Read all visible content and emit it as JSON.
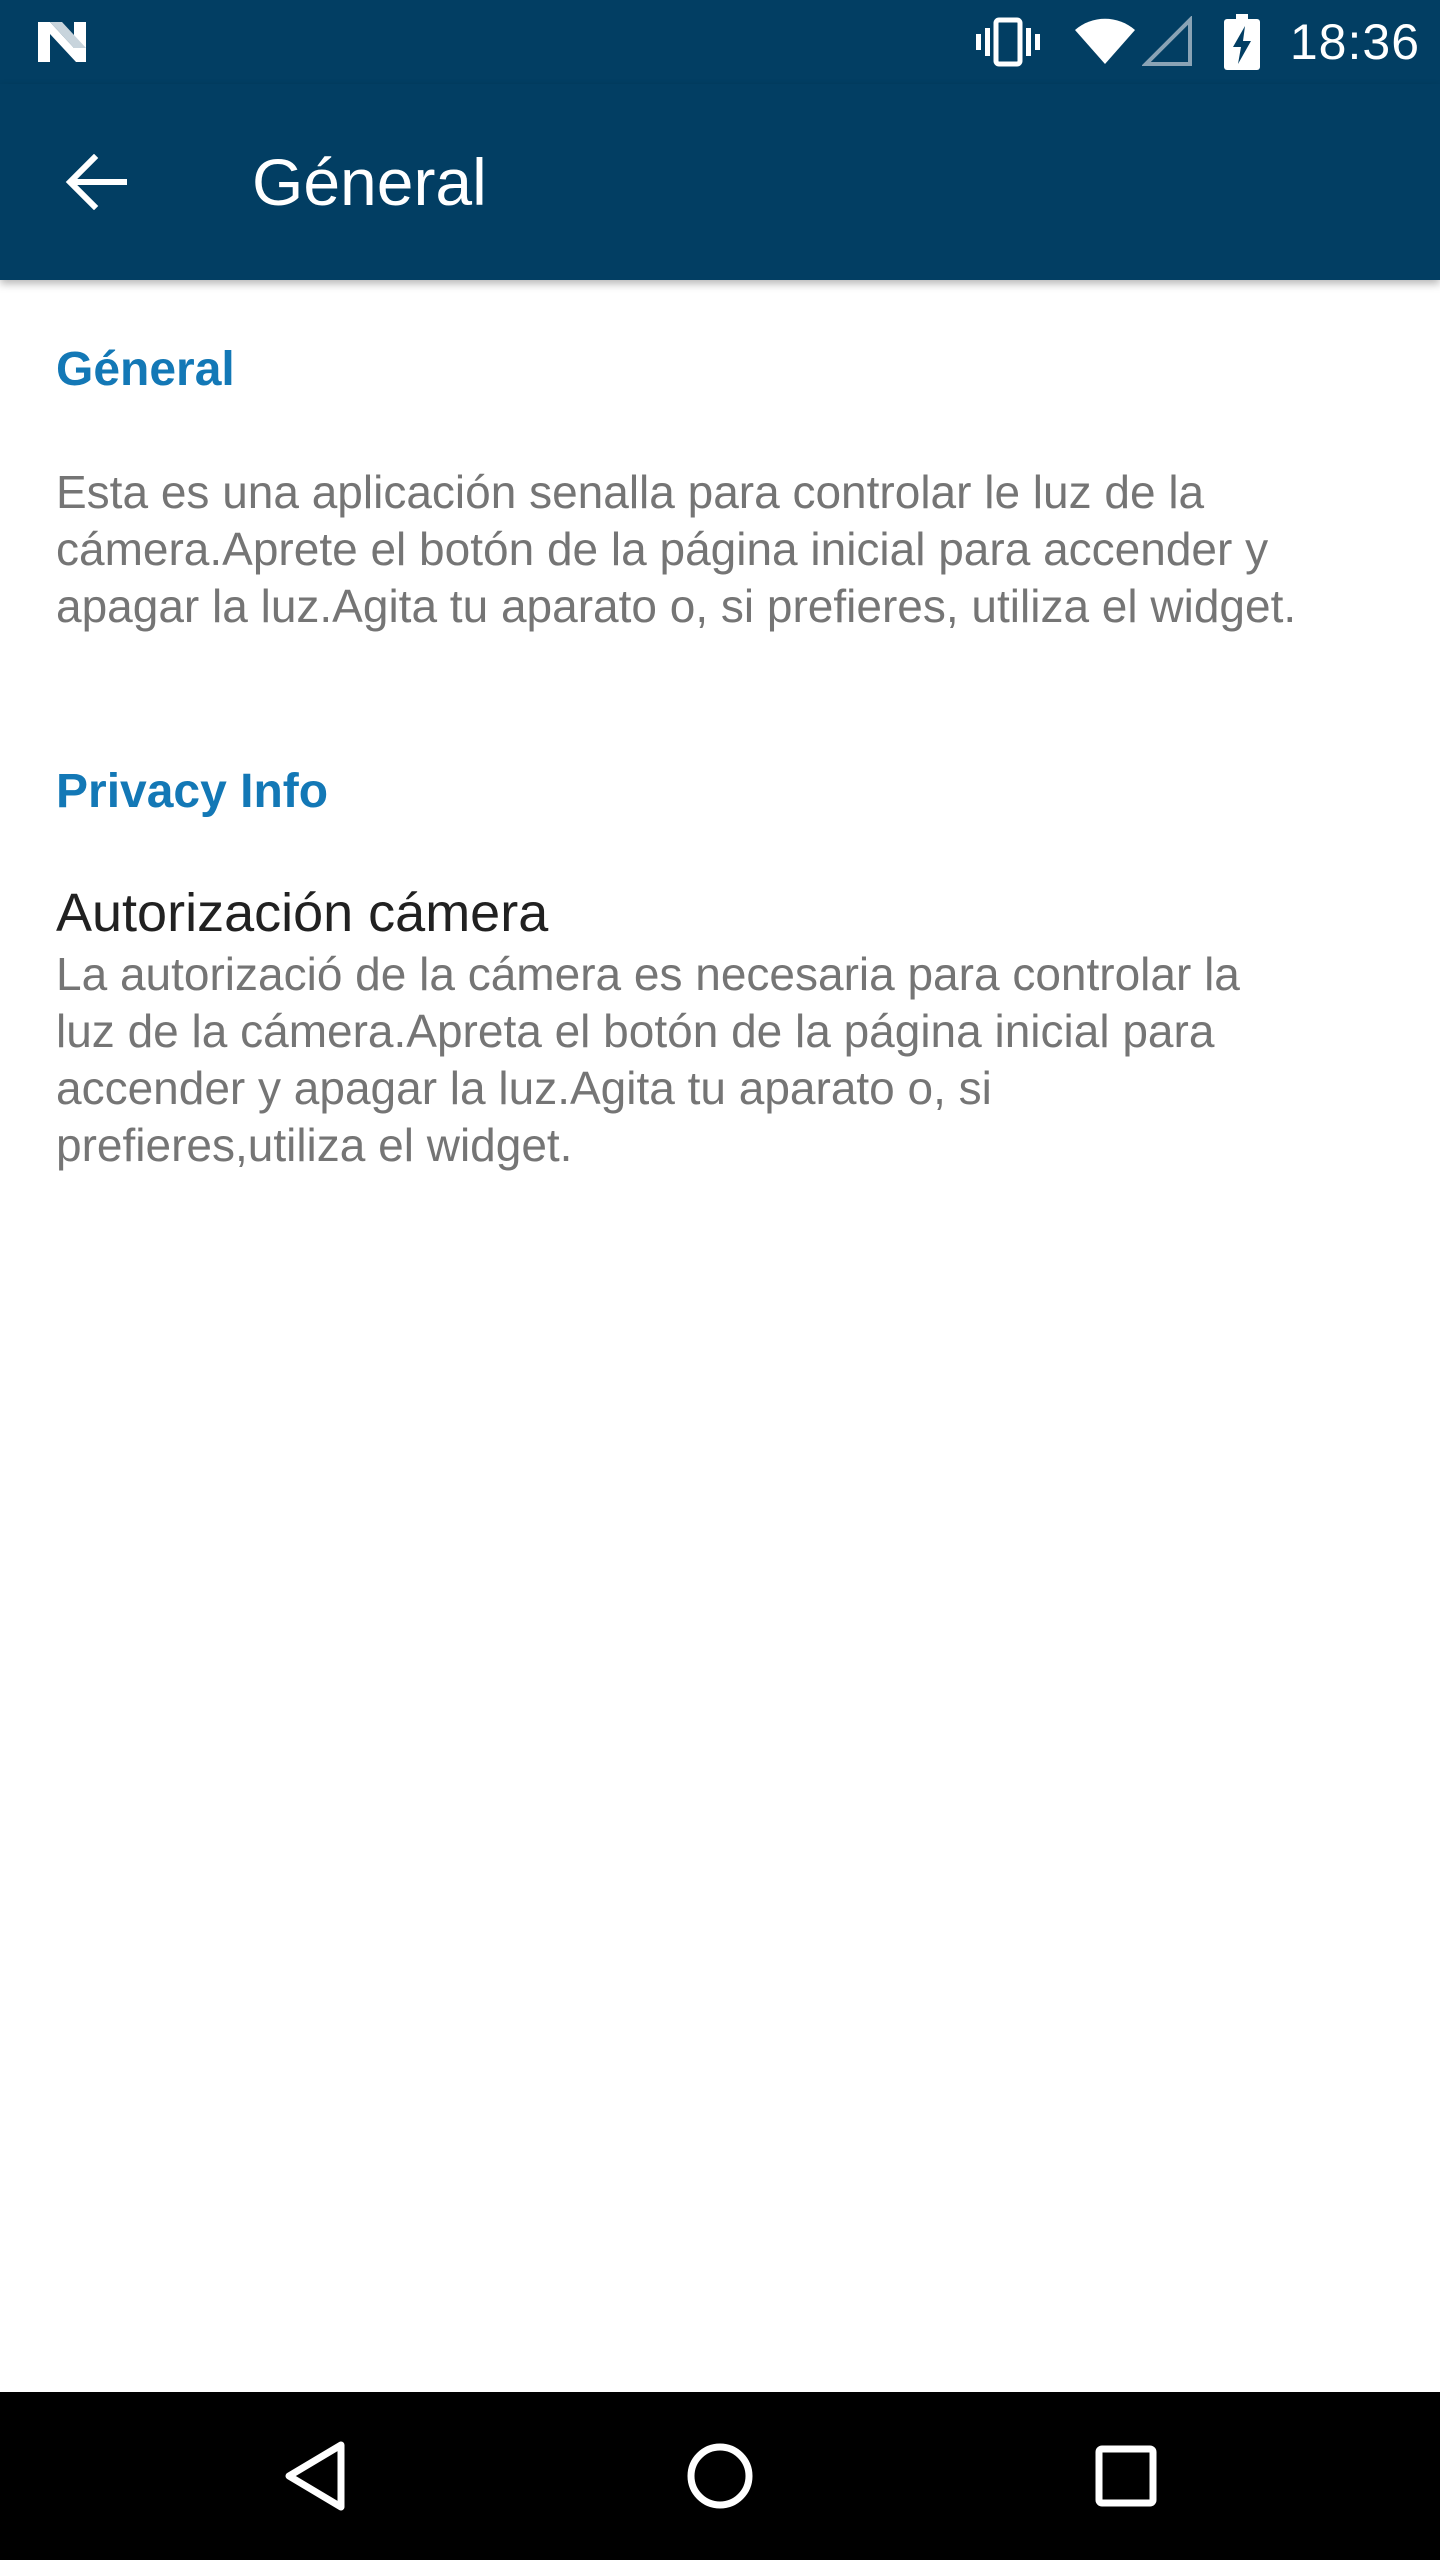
{
  "status_bar": {
    "time": "18:36",
    "icons": [
      "android-n-icon",
      "vibrate-icon",
      "wifi-icon",
      "cell-signal-icon",
      "battery-charging-icon"
    ]
  },
  "toolbar": {
    "title": "Géneral",
    "back_icon": "arrow-back-icon"
  },
  "sections": {
    "general": {
      "header": "Géneral",
      "summary": "Esta es una aplicación senalla para controlar le luz de la cámera.Aprete el botón de la página inicial para accender y apagar la luz.Agita tu aparato o, si prefieres, utiliza el widget."
    },
    "privacy": {
      "header": "Privacy Info",
      "item_title": "Autorización cámera",
      "item_summary": "La autorizació de la cámera es necesaria para controlar la luz de la cámera.Apreta el botón de la página inicial para accender y apagar la luz.Agita tu aparato o, si prefieres,utiliza el widget."
    }
  },
  "nav_bar": {
    "buttons": [
      "nav-back-icon",
      "nav-home-icon",
      "nav-recents-icon"
    ]
  },
  "colors": {
    "primary_dark": "#023e63",
    "accent": "#1378b6",
    "summary_text": "#757575",
    "title_text": "#212121",
    "nav_bar": "#000000"
  }
}
